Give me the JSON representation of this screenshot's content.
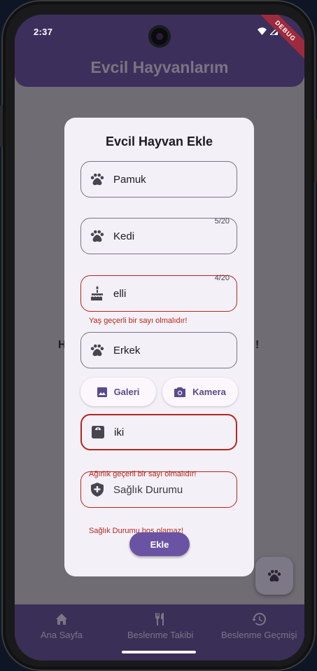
{
  "status": {
    "time": "2:37"
  },
  "app": {
    "title": "Evcil Hayvanlarım",
    "debug_label": "DEBUG"
  },
  "background": {
    "left_fragment": "H",
    "right_fragment": "!"
  },
  "dialog": {
    "title": "Evcil Hayvan Ekle",
    "fields": {
      "name": {
        "value": "Pamuk",
        "counter": "5/20",
        "icon": "paw-icon"
      },
      "species": {
        "value": "Kedi",
        "counter": "4/20",
        "icon": "paw-icon"
      },
      "age": {
        "value": "elli",
        "error": "Yaş geçerli bir sayı olmalıdır!",
        "icon": "cake-icon"
      },
      "gender": {
        "value": "Erkek",
        "icon": "paw-icon"
      },
      "weight": {
        "value": "iki",
        "error": "Ağırlık geçerli bir sayı olmalıdır!",
        "icon": "scale-icon"
      },
      "health": {
        "placeholder": "Sağlık Durumu",
        "error": "Sağlık Durumu boş olamaz!",
        "icon": "health-shield-icon"
      }
    },
    "gallery_label": "Galeri",
    "camera_label": "Kamera",
    "submit_label": "Ekle"
  },
  "bottom_nav": {
    "items": [
      {
        "label": "Ana Sayfa",
        "icon": "home-icon"
      },
      {
        "label": "Beslenme Takibi",
        "icon": "restaurant-icon"
      },
      {
        "label": "Beslenme Geçmişi",
        "icon": "history-icon"
      }
    ]
  },
  "colors": {
    "primary": "#6a53a3",
    "app_bar": "#3d2f5b",
    "error": "#b3261e",
    "dialog_bg": "#f4f0f7"
  }
}
